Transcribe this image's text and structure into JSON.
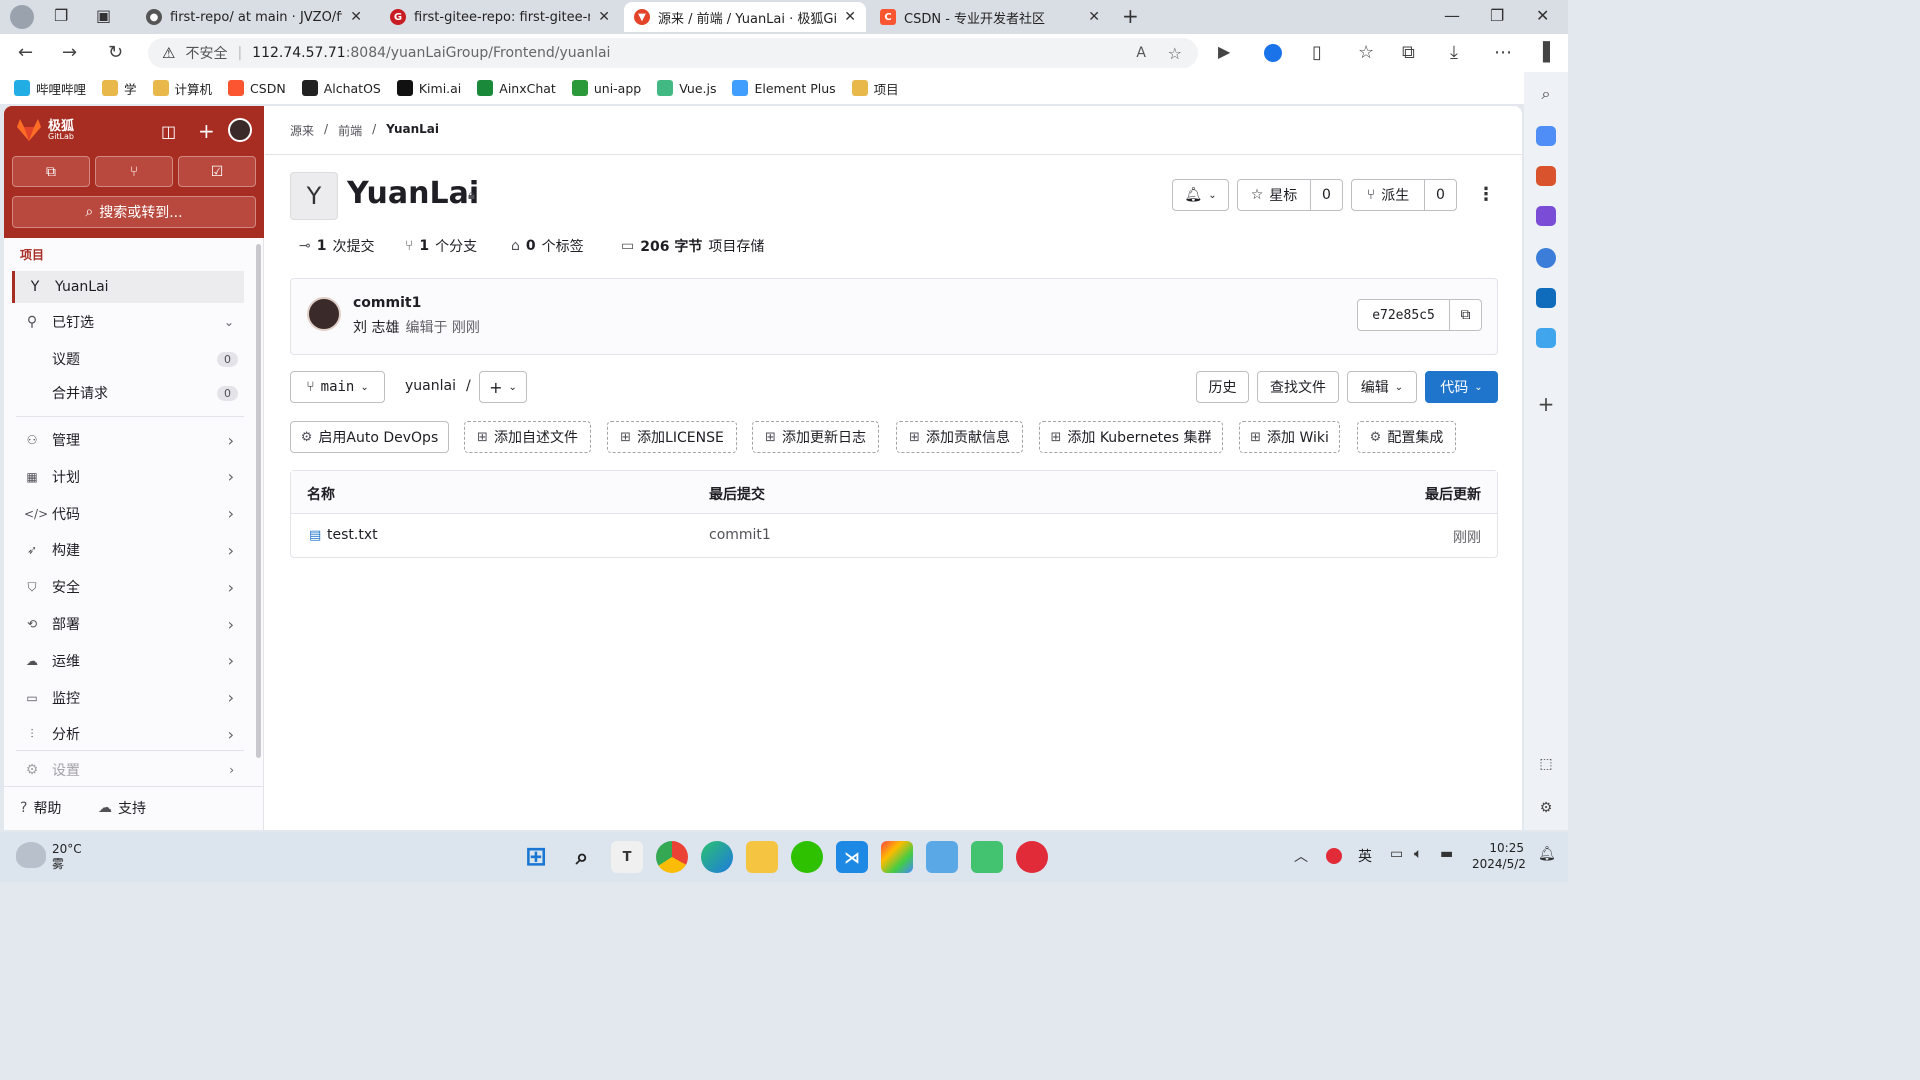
{
  "browser": {
    "tabs": [
      {
        "title": "first-repo/ at main · JVZO/first-re",
        "icon": "github-icon"
      },
      {
        "title": "first-gitee-repo: first-gitee-repo",
        "icon": "gitee-icon"
      },
      {
        "title": "源来 / 前端 / YuanLai · 极狐GitLa",
        "icon": "gitlab-icon",
        "active": true
      },
      {
        "title": "CSDN - 专业开发者社区",
        "icon": "csdn-icon"
      }
    ],
    "security_label": "不安全",
    "url_host": "112.74.57.71",
    "url_rest": ":8084/yuanLaiGroup/Frontend/yuanlai",
    "bookmarks": [
      {
        "label": "哔哩哔哩",
        "color": "#23ade5"
      },
      {
        "label": "学",
        "color": "#e8b84a"
      },
      {
        "label": "计算机",
        "color": "#e8b84a"
      },
      {
        "label": "CSDN",
        "color": "#fc5531"
      },
      {
        "label": "AlchatOS",
        "color": "#222222"
      },
      {
        "label": "Kimi.ai",
        "color": "#111111"
      },
      {
        "label": "AinxChat",
        "color": "#1a8a3a"
      },
      {
        "label": "uni-app",
        "color": "#2b9939"
      },
      {
        "label": "Vue.js",
        "color": "#42b883"
      },
      {
        "label": "Element Plus",
        "color": "#409eff"
      },
      {
        "label": "项目",
        "color": "#e8b84a"
      }
    ]
  },
  "sidebar": {
    "brand_name": "极狐",
    "brand_sub": "GitLab",
    "search_label": "搜索或转到...",
    "section_label": "项目",
    "project_initial": "Y",
    "project_name": "YuanLai",
    "pinned_label": "已钉选",
    "pinned": [
      {
        "label": "议题",
        "count": "0"
      },
      {
        "label": "合并请求",
        "count": "0"
      }
    ],
    "menu": [
      {
        "label": "管理",
        "icon": "users-icon",
        "glyph": "⚇"
      },
      {
        "label": "计划",
        "icon": "calendar-icon",
        "glyph": "▦"
      },
      {
        "label": "代码",
        "icon": "code-icon",
        "glyph": "</>"
      },
      {
        "label": "构建",
        "icon": "rocket-icon",
        "glyph": "➶"
      },
      {
        "label": "安全",
        "icon": "shield-icon",
        "glyph": "⛉"
      },
      {
        "label": "部署",
        "icon": "deploy-icon",
        "glyph": "⟲"
      },
      {
        "label": "运维",
        "icon": "cloud-icon",
        "glyph": "☁"
      },
      {
        "label": "监控",
        "icon": "monitor-icon",
        "glyph": "▭"
      },
      {
        "label": "分析",
        "icon": "chart-icon",
        "glyph": "⫶"
      }
    ],
    "settings_label": "设置",
    "help_label": "帮助",
    "support_label": "支持"
  },
  "breadcrumb": [
    "源来",
    "前端",
    "YuanLai"
  ],
  "project": {
    "avatar_letter": "Y",
    "title": "YuanLai",
    "star_label": "星标",
    "star_count": "0",
    "fork_label": "派生",
    "fork_count": "0",
    "stats": [
      {
        "num": "1",
        "text": "次提交",
        "icon": "commit-icon",
        "glyph": "⊸"
      },
      {
        "num": "1",
        "text": "个分支",
        "icon": "branch-icon",
        "glyph": "⑂"
      },
      {
        "num": "0",
        "text": "个标签",
        "icon": "tag-icon",
        "glyph": "⌂"
      },
      {
        "num": "206 字节",
        "text": "项目存储",
        "icon": "storage-icon",
        "glyph": "▭"
      }
    ]
  },
  "commit": {
    "title": "commit1",
    "author": "刘 志雄",
    "meta": "编辑于 刚刚",
    "sha": "e72e85c5"
  },
  "repo_toolbar": {
    "branch": "main",
    "path": "yuanlai",
    "history": "历史",
    "find_file": "查找文件",
    "edit": "编辑",
    "code": "代码"
  },
  "quick_actions": [
    "启用Auto DevOps",
    "添加自述文件",
    "添加LICENSE",
    "添加更新日志",
    "添加贡献信息",
    "添加 Kubernetes 集群",
    "添加 Wiki",
    "配置集成"
  ],
  "files": {
    "headers": [
      "名称",
      "最后提交",
      "最后更新"
    ],
    "rows": [
      {
        "name": "test.txt",
        "commit": "commit1",
        "updated": "刚刚"
      }
    ]
  },
  "taskbar": {
    "temp": "20°C",
    "weather": "雾",
    "lang": "英",
    "time": "10:25",
    "date": "2024/5/2"
  },
  "colors": {
    "gitlab_brand": "#a72c21",
    "primary_button": "#1f75cb"
  }
}
